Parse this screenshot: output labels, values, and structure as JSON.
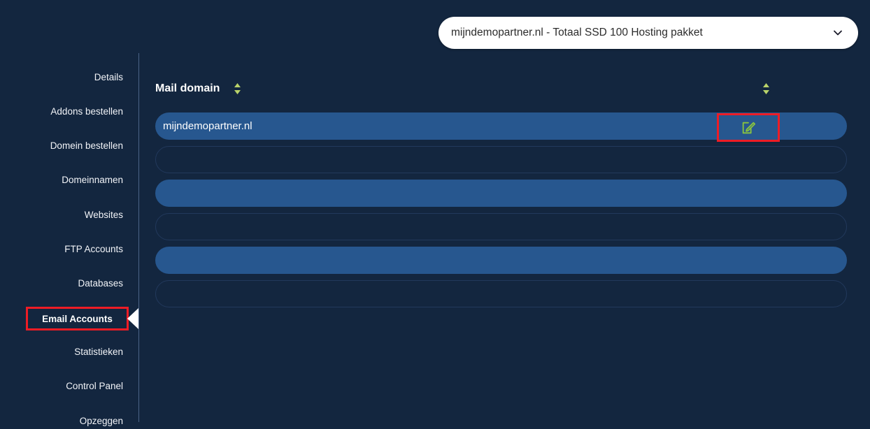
{
  "header": {
    "package_selector": {
      "value": "mijndemopartner.nl - Totaal SSD 100 Hosting pakket",
      "chevron_icon": "chevron-down-icon"
    }
  },
  "sidebar": {
    "items": [
      {
        "label": "Details",
        "active": false
      },
      {
        "label": "Addons bestellen",
        "active": false
      },
      {
        "label": "Domein bestellen",
        "active": false
      },
      {
        "label": "Domeinnamen",
        "active": false
      },
      {
        "label": "Websites",
        "active": false
      },
      {
        "label": "FTP Accounts",
        "active": false
      },
      {
        "label": "Databases",
        "active": false
      },
      {
        "label": "Email Accounts",
        "active": true
      },
      {
        "label": "Statistieken",
        "active": false
      },
      {
        "label": "Control Panel",
        "active": false
      },
      {
        "label": "Opzeggen",
        "active": false
      }
    ],
    "active_item": "Email Accounts"
  },
  "main": {
    "table": {
      "columns": [
        {
          "label": "Mail domain",
          "sort_icon": "sort-updown-icon"
        },
        {
          "label": "",
          "sort_icon": "sort-updown-icon"
        }
      ],
      "rows": [
        {
          "mail_domain": "mijndemopartner.nl",
          "style": "filled",
          "action_icon": "edit-icon"
        },
        {
          "mail_domain": "",
          "style": "outlined",
          "action_icon": ""
        },
        {
          "mail_domain": "",
          "style": "filled",
          "action_icon": ""
        },
        {
          "mail_domain": "",
          "style": "outlined",
          "action_icon": ""
        },
        {
          "mail_domain": "",
          "style": "filled",
          "action_icon": ""
        },
        {
          "mail_domain": "",
          "style": "outlined",
          "action_icon": ""
        }
      ]
    },
    "edit_button": {
      "icon": "edit-icon",
      "tooltip": ""
    }
  },
  "colors": {
    "page_background": "#13263f",
    "row_filled": "#27578f",
    "row_outline": "#22395c",
    "highlight_red": "#ee1c25",
    "accent_green": "#8ac43f",
    "selector_background": "#ffffff",
    "divider": "#4a6387"
  }
}
